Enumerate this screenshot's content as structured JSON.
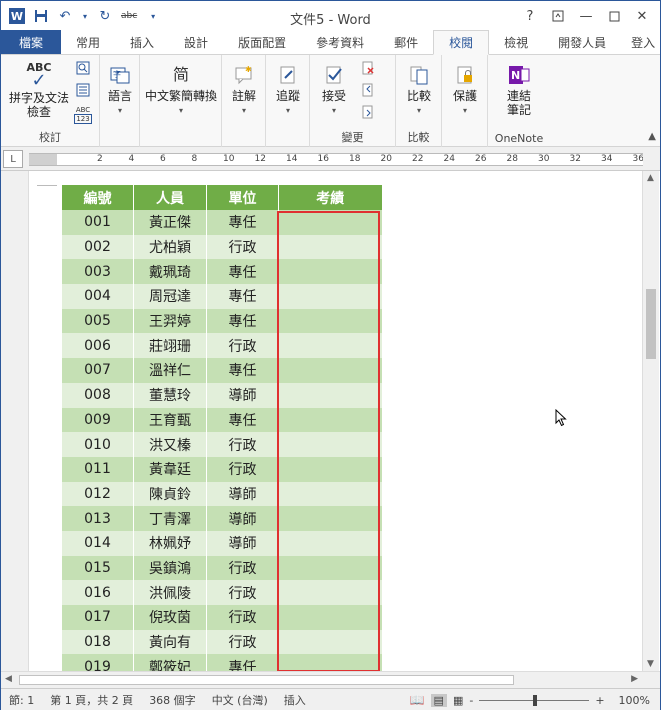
{
  "app": {
    "title": "文件5 - Word",
    "help_label": "?",
    "window_buttons": [
      "?",
      "restore-ribbon",
      "minimize",
      "maximize",
      "close"
    ],
    "signin_label": "登入"
  },
  "qat": {
    "abc_label": "abc"
  },
  "tabs": [
    {
      "label": "檔案"
    },
    {
      "label": "常用"
    },
    {
      "label": "插入"
    },
    {
      "label": "設計"
    },
    {
      "label": "版面配置"
    },
    {
      "label": "參考資料"
    },
    {
      "label": "郵件"
    },
    {
      "label": "校閱"
    },
    {
      "label": "檢視"
    },
    {
      "label": "開發人員"
    }
  ],
  "ribbon": {
    "spell": {
      "abc": "ABC",
      "label1": "拼字及文法",
      "label2": "檢查",
      "small_abc": "ABC",
      "small_num": "123",
      "group": "校訂"
    },
    "language": {
      "label": "語言"
    },
    "chinese": {
      "glyph": "简",
      "label": "中文繁簡轉換"
    },
    "comment": {
      "label": "註解"
    },
    "track": {
      "label": "追蹤"
    },
    "accept": {
      "label": "接受",
      "group": "變更"
    },
    "compare": {
      "label": "比較",
      "group": "比較"
    },
    "protect": {
      "label": "保護"
    },
    "onenote": {
      "label1": "連結",
      "label2": "筆記",
      "group": "OneNote"
    }
  },
  "ruler": {
    "corner": "L",
    "ticks": [
      "2",
      "4",
      "6",
      "8",
      "10",
      "12",
      "14",
      "16",
      "18",
      "20",
      "22",
      "24",
      "26",
      "28",
      "30",
      "32",
      "34",
      "36"
    ]
  },
  "table": {
    "headers": [
      "編號",
      "人員",
      "單位",
      "考績"
    ],
    "rows": [
      [
        "001",
        "黃正傑",
        "專任",
        ""
      ],
      [
        "002",
        "尤柏穎",
        "行政",
        ""
      ],
      [
        "003",
        "戴珮琦",
        "專任",
        ""
      ],
      [
        "004",
        "周冠達",
        "專任",
        ""
      ],
      [
        "005",
        "王羿婷",
        "專任",
        ""
      ],
      [
        "006",
        "莊翊珊",
        "行政",
        ""
      ],
      [
        "007",
        "溫祥仁",
        "專任",
        ""
      ],
      [
        "008",
        "董慧玲",
        "導師",
        ""
      ],
      [
        "009",
        "王育甄",
        "專任",
        ""
      ],
      [
        "010",
        "洪又榛",
        "行政",
        ""
      ],
      [
        "011",
        "黃韋廷",
        "行政",
        ""
      ],
      [
        "012",
        "陳貞鈴",
        "導師",
        ""
      ],
      [
        "013",
        "丁青澤",
        "導師",
        ""
      ],
      [
        "014",
        "林姵妤",
        "導師",
        ""
      ],
      [
        "015",
        "吳鎮鴻",
        "行政",
        ""
      ],
      [
        "016",
        "洪佩陵",
        "行政",
        ""
      ],
      [
        "017",
        "倪玫茵",
        "行政",
        ""
      ],
      [
        "018",
        "黃向有",
        "行政",
        ""
      ],
      [
        "019",
        "鄭筱妃",
        "專任",
        ""
      ]
    ]
  },
  "status": {
    "section": "節: 1",
    "page": "第 1 頁，共 2 頁",
    "words": "368 個字",
    "language": "中文 (台灣)",
    "mode": "插入",
    "zoom": "100%",
    "zoom_minus": "-",
    "zoom_plus": "+"
  },
  "colors": {
    "accent": "#2b579a",
    "table_header": "#70ad47",
    "row_dark": "#c5e0b4",
    "row_light": "#e2efda",
    "highlight_box": "#e03030"
  }
}
